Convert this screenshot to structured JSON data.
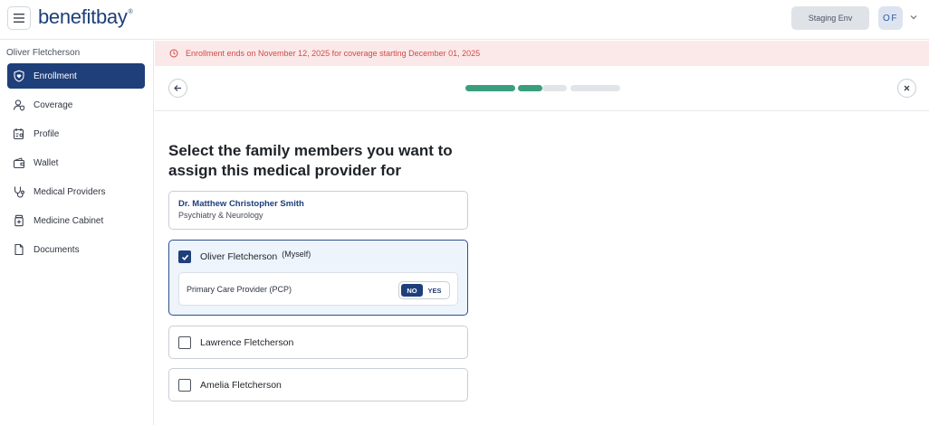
{
  "header": {
    "logo_text": "benefitbay",
    "logo_mark": "®",
    "env_label": "Staging Env",
    "avatar_initials": "OF"
  },
  "sidebar": {
    "user_name": "Oliver Fletcherson",
    "items": [
      {
        "label": "Enrollment",
        "icon": "shield-heart-icon",
        "active": true
      },
      {
        "label": "Coverage",
        "icon": "person-shield-icon",
        "active": false
      },
      {
        "label": "Profile",
        "icon": "profile-card-icon",
        "active": false
      },
      {
        "label": "Wallet",
        "icon": "wallet-icon",
        "active": false
      },
      {
        "label": "Medical Providers",
        "icon": "stethoscope-icon",
        "active": false
      },
      {
        "label": "Medicine Cabinet",
        "icon": "medicine-bottle-icon",
        "active": false
      },
      {
        "label": "Documents",
        "icon": "document-icon",
        "active": false
      }
    ]
  },
  "banner": {
    "text": "Enrollment ends on November 12, 2025 for coverage starting December 01, 2025",
    "color": "#cf4b4b"
  },
  "progress": {
    "steps_total": 4,
    "steps_complete": 2,
    "colors": {
      "complete": "#3a9e7e",
      "pending": "#e1e4e8"
    }
  },
  "main": {
    "title": "Select the family members you want to assign this medical provider for",
    "provider": {
      "name": "Dr. Matthew Christopher Smith",
      "specialty": "Psychiatry & Neurology"
    },
    "members": [
      {
        "name": "Oliver Fletcherson",
        "tag": "(Myself)",
        "checked": true,
        "pcp": {
          "label": "Primary Care Provider (PCP)",
          "no_label": "NO",
          "yes_label": "YES",
          "value": "NO"
        }
      },
      {
        "name": "Lawrence Fletcherson",
        "checked": false
      },
      {
        "name": "Amelia Fletcherson",
        "checked": false
      }
    ]
  },
  "colors": {
    "brand": "#1e3f7a",
    "accent": "#3a9e7e"
  }
}
